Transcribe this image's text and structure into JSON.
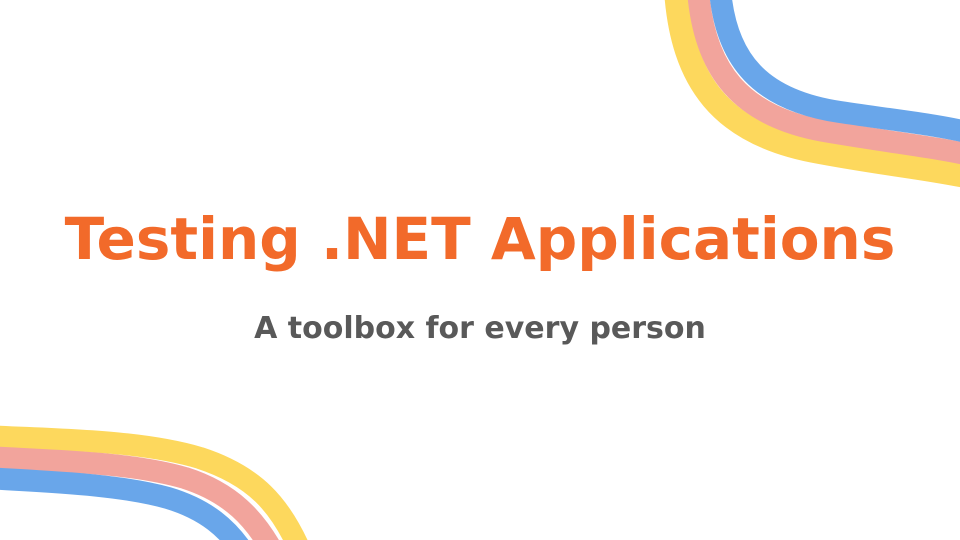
{
  "slide": {
    "title": "Testing .NET Applications",
    "subtitle": "A toolbox for every person"
  },
  "colors": {
    "background": "#ffffff",
    "title": "#f26a2a",
    "subtitle": "#595959",
    "stripe_yellow": "#fdd85d",
    "stripe_pink": "#f2a49c",
    "stripe_blue": "#69a6ea"
  }
}
